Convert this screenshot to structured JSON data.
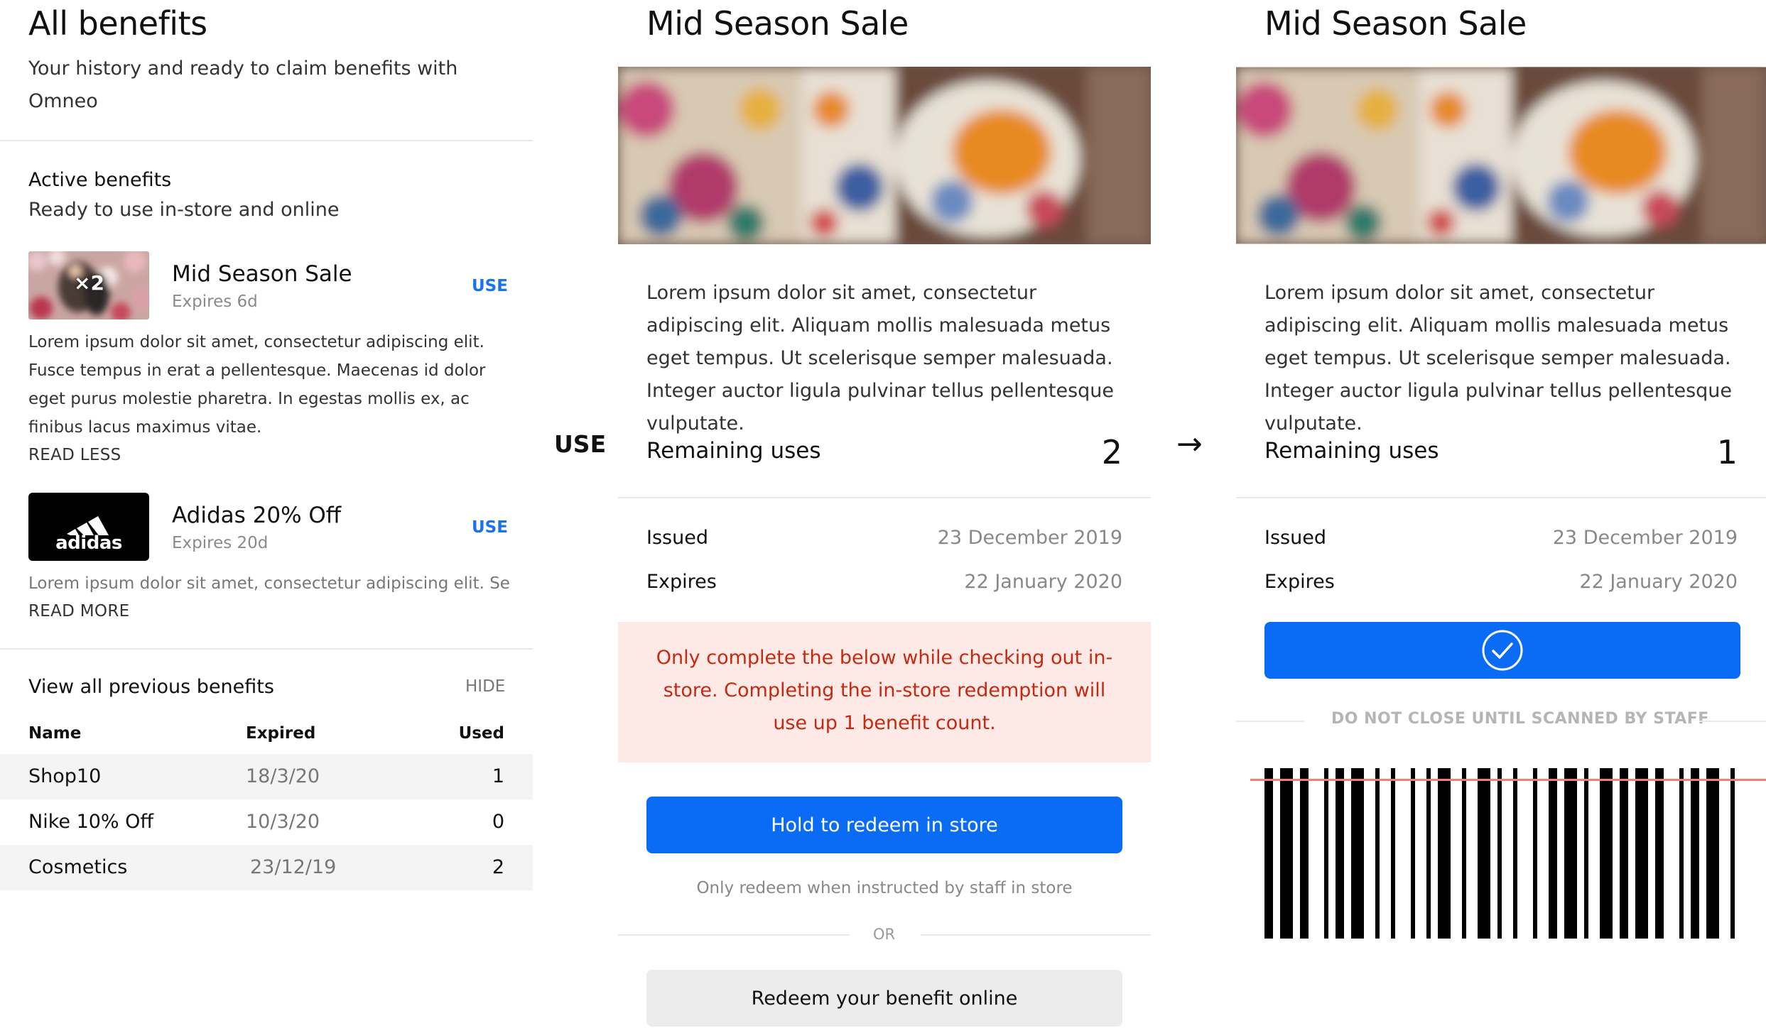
{
  "left": {
    "title": "All benefits",
    "subtitle": "Your history and ready to claim benefits with Omneo",
    "active": {
      "title": "Active benefits",
      "subtitle": "Ready to use in-store and online",
      "items": [
        {
          "name": "Mid Season Sale",
          "expires": "Expires 6d",
          "use": "USE",
          "badge": "×2",
          "description": "Lorem ipsum dolor sit amet, consectetur adipiscing elit. Fusce tempus in erat a pellentesque. Maecenas id dolor eget purus molestie pharetra. In egestas mollis ex, ac finibus lacus maximus vitae.",
          "toggle": "READ LESS"
        },
        {
          "name": "Adidas 20% Off",
          "expires": "Expires 20d",
          "use": "USE",
          "logo_text": "adidas",
          "description": "Lorem ipsum dolor sit amet, consectetur adipiscing elit. Se...",
          "toggle": "READ MORE"
        }
      ]
    },
    "previous": {
      "title": "View all previous benefits",
      "hide": "HIDE",
      "columns": [
        "Name",
        "Expired",
        "Used"
      ],
      "rows": [
        {
          "name": "Shop10",
          "expired": "18/3/20",
          "used": "1"
        },
        {
          "name": "Nike 10% Off",
          "expired": "10/3/20",
          "used": "0"
        },
        {
          "name": "Cosmetics",
          "expired": "23/12/19",
          "used": "2"
        }
      ]
    }
  },
  "between": {
    "use_label": "USE",
    "arrow": "→"
  },
  "middle": {
    "title": "Mid Season Sale",
    "description": "Lorem ipsum dolor sit amet, consectetur adipiscing elit. Aliquam mollis malesuada metus eget tempus. Ut scelerisque semper malesuada. Integer auctor ligula pulvinar tellus pellentesque vulputate.",
    "remaining_label": "Remaining uses",
    "remaining_value": "2",
    "issued_label": "Issued",
    "issued_value": "23 December 2019",
    "expires_label": "Expires",
    "expires_value": "22 January 2020",
    "warning": "Only complete the below while checking out in-store. Completing the in-store redemption will use up 1 benefit count.",
    "hold_button": "Hold to redeem in store",
    "hold_note": "Only redeem when instructed by staff in store",
    "or": "OR",
    "online_button": "Redeem your benefit online"
  },
  "right": {
    "title": "Mid Season Sale",
    "description": "Lorem ipsum dolor sit amet, consectetur adipiscing elit. Aliquam mollis malesuada metus eget tempus. Ut scelerisque semper malesuada. Integer auctor ligula pulvinar tellus pellentesque vulputate.",
    "remaining_label": "Remaining uses",
    "remaining_value": "1",
    "issued_label": "Issued",
    "issued_value": "23 December 2019",
    "expires_label": "Expires",
    "expires_value": "22 January 2020",
    "scan_notice": "DO NOT CLOSE UNTIL SCANNED BY STAFF"
  },
  "colors": {
    "accent": "#0a6cf5",
    "link": "#1a73e8",
    "warning_bg": "#fde9e5",
    "warning_text": "#c42a12",
    "scan_line": "#f08070"
  }
}
